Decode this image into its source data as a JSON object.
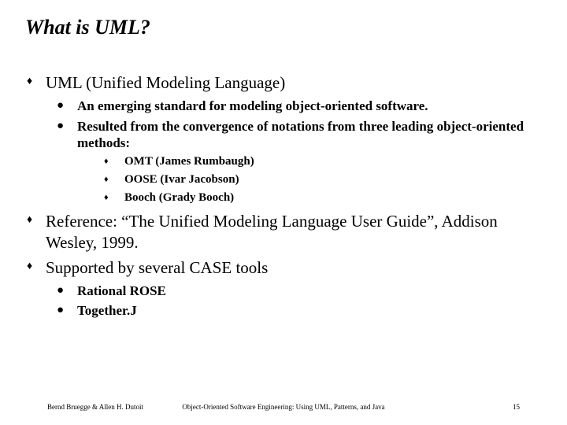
{
  "title": "What is UML?",
  "items": {
    "uml_heading": "UML (Unified Modeling Language)",
    "uml_sub1": "An emerging standard for modeling object-oriented software.",
    "uml_sub2": "Resulted from the convergence of notations from three leading object-oriented methods:",
    "method1": "OMT  (James Rumbaugh)",
    "method2": "OOSE (Ivar Jacobson)",
    "method3": "Booch (Grady Booch)",
    "ref": "Reference: “The Unified Modeling Language User Guide”, Addison Wesley, 1999.",
    "case": "Supported by several CASE tools",
    "case1": "Rational ROSE",
    "case2": "Together.J"
  },
  "bullets": {
    "diamond": "♦",
    "round": "●",
    "small": "♦"
  },
  "footer": {
    "left": "Bernd Bruegge & Allen H. Dutoit",
    "center": "Object-Oriented Software Engineering: Using UML, Patterns, and Java",
    "page": "15"
  }
}
